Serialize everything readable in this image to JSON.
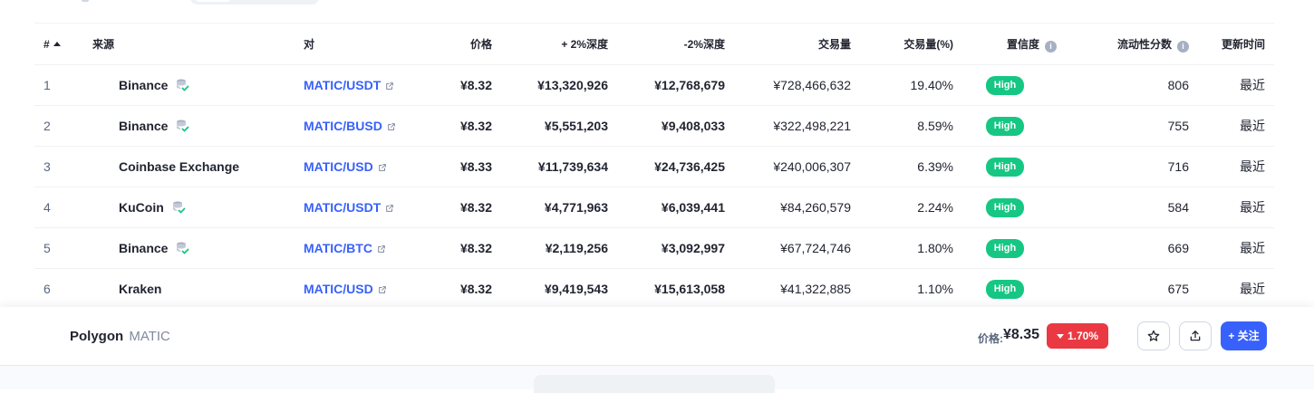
{
  "table": {
    "headers": {
      "num": "#",
      "source": "来源",
      "pair": "对",
      "price": "价格",
      "depth_pos": "+ 2%深度",
      "depth_neg": "-2%深度",
      "volume": "交易量",
      "volume_pct": "交易量(%)",
      "confidence": "置信度",
      "liquidity": "流动性分数",
      "updated": "更新时间"
    },
    "rows": [
      {
        "num": "1",
        "source": "Binance",
        "verified": true,
        "pair": "MATIC/USDT",
        "price": "¥8.32",
        "depth_pos": "¥13,320,926",
        "depth_neg": "¥12,768,679",
        "volume": "¥728,466,632",
        "volume_pct": "19.40%",
        "confidence": "High",
        "liquidity": "806",
        "updated": "最近"
      },
      {
        "num": "2",
        "source": "Binance",
        "verified": true,
        "pair": "MATIC/BUSD",
        "price": "¥8.32",
        "depth_pos": "¥5,551,203",
        "depth_neg": "¥9,408,033",
        "volume": "¥322,498,221",
        "volume_pct": "8.59%",
        "confidence": "High",
        "liquidity": "755",
        "updated": "最近"
      },
      {
        "num": "3",
        "source": "Coinbase Exchange",
        "verified": false,
        "pair": "MATIC/USD",
        "price": "¥8.33",
        "depth_pos": "¥11,739,634",
        "depth_neg": "¥24,736,425",
        "volume": "¥240,006,307",
        "volume_pct": "6.39%",
        "confidence": "High",
        "liquidity": "716",
        "updated": "最近"
      },
      {
        "num": "4",
        "source": "KuCoin",
        "verified": true,
        "pair": "MATIC/USDT",
        "price": "¥8.32",
        "depth_pos": "¥4,771,963",
        "depth_neg": "¥6,039,441",
        "volume": "¥84,260,579",
        "volume_pct": "2.24%",
        "confidence": "High",
        "liquidity": "584",
        "updated": "最近"
      },
      {
        "num": "5",
        "source": "Binance",
        "verified": true,
        "pair": "MATIC/BTC",
        "price": "¥8.32",
        "depth_pos": "¥2,119,256",
        "depth_neg": "¥3,092,997",
        "volume": "¥67,724,746",
        "volume_pct": "1.80%",
        "confidence": "High",
        "liquidity": "669",
        "updated": "最近"
      },
      {
        "num": "6",
        "source": "Kraken",
        "verified": false,
        "pair": "MATIC/USD",
        "price": "¥8.32",
        "depth_pos": "¥9,419,543",
        "depth_neg": "¥15,613,058",
        "volume": "¥41,322,885",
        "volume_pct": "1.10%",
        "confidence": "High",
        "liquidity": "675",
        "updated": "最近"
      }
    ]
  },
  "bottom_bar": {
    "coin_name": "Polygon",
    "coin_symbol": "MATIC",
    "price_label": "价格:",
    "price_value": "¥8.35",
    "change": "1.70%",
    "follow_label": "+ 关注"
  },
  "colors": {
    "accent": "#3861fb",
    "positive": "#16c784",
    "negative": "#ea3943",
    "text": "#222531",
    "muted": "#58667e"
  },
  "icons": {
    "sort": "sort-asc-icon",
    "info": "info-icon",
    "external": "external-link-icon",
    "verified": "verified-stack-icon",
    "star": "star-icon",
    "share": "share-icon",
    "caret": "caret-down-icon"
  }
}
